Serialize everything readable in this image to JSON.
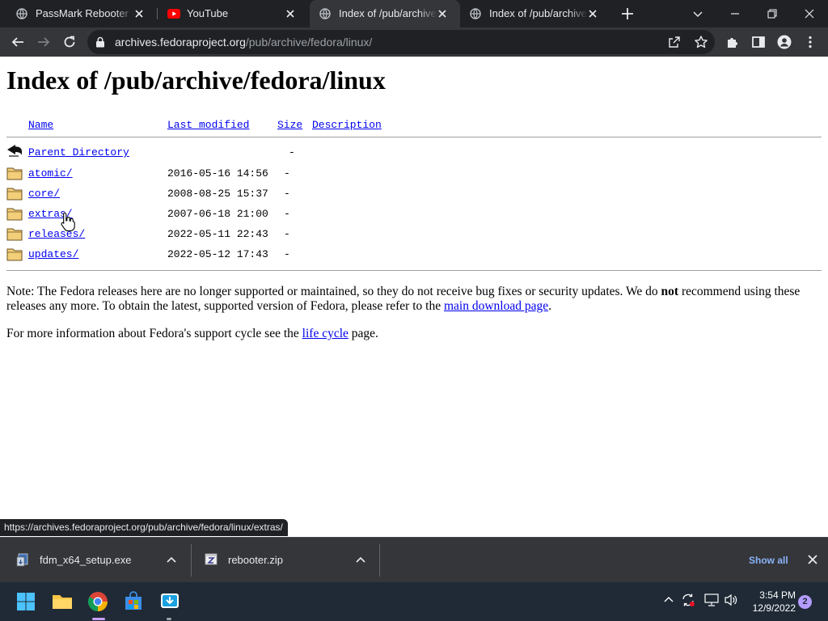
{
  "browser": {
    "tabs": [
      {
        "title": "PassMark Rebooter - Re",
        "favicon": "passmark-globe-icon",
        "active": false
      },
      {
        "title": "YouTube",
        "favicon": "youtube-icon",
        "active": false
      },
      {
        "title": "Index of /pub/archive/f",
        "favicon": "globe-icon",
        "active": true
      },
      {
        "title": "Index of /pub/archive/f",
        "favicon": "globe-icon",
        "active": false
      }
    ],
    "address": {
      "host": "archives.fedoraproject.org",
      "path": "/pub/archive/fedora/linux/"
    },
    "status_url": "https://archives.fedoraproject.org/pub/archive/fedora/linux/extras/"
  },
  "page": {
    "title": "Index of /pub/archive/fedora/linux",
    "columns": {
      "name": "Name",
      "last_modified": "Last modified",
      "size": "Size",
      "description": "Description"
    },
    "entries": [
      {
        "name": "Parent Directory",
        "date": "",
        "size": "-",
        "icon": "back-arrow-icon"
      },
      {
        "name": "atomic/",
        "date": "2016-05-16 14:56",
        "size": "-",
        "icon": "folder-icon"
      },
      {
        "name": "core/",
        "date": "2008-08-25 15:37",
        "size": "-",
        "icon": "folder-icon"
      },
      {
        "name": "extras/",
        "date": "2007-06-18 21:00",
        "size": "-",
        "icon": "folder-icon"
      },
      {
        "name": "releases/",
        "date": "2022-05-11 22:43",
        "size": "-",
        "icon": "folder-icon"
      },
      {
        "name": "updates/",
        "date": "2022-05-12 17:43",
        "size": "-",
        "icon": "folder-icon"
      }
    ],
    "note": {
      "part1": "Note: The Fedora releases here are no longer supported or maintained, so they do not receive bug fixes or security updates. We do ",
      "bold": "not",
      "part2": " recommend using these releases any more. To obtain the latest, supported version of Fedora, please refer to the ",
      "link": "main download page",
      "part3": "."
    },
    "info": {
      "part1": "For more information about Fedora's support cycle see the ",
      "link": "life cycle",
      "part2": " page."
    }
  },
  "downloads": {
    "items": [
      {
        "name": "fdm_x64_setup.exe",
        "icon": "installer-icon"
      },
      {
        "name": "rebooter.zip",
        "icon": "zip-file-icon"
      }
    ],
    "show_all": "Show all"
  },
  "taskbar": {
    "time": "3:54 PM",
    "date": "12/9/2022",
    "notifications": "2"
  },
  "colors": {
    "link": "#0000ee",
    "tab_strip": "#202124",
    "toolbar": "#35363a",
    "taskbar": "#1f2a36",
    "show_all": "#8ab4f8"
  }
}
